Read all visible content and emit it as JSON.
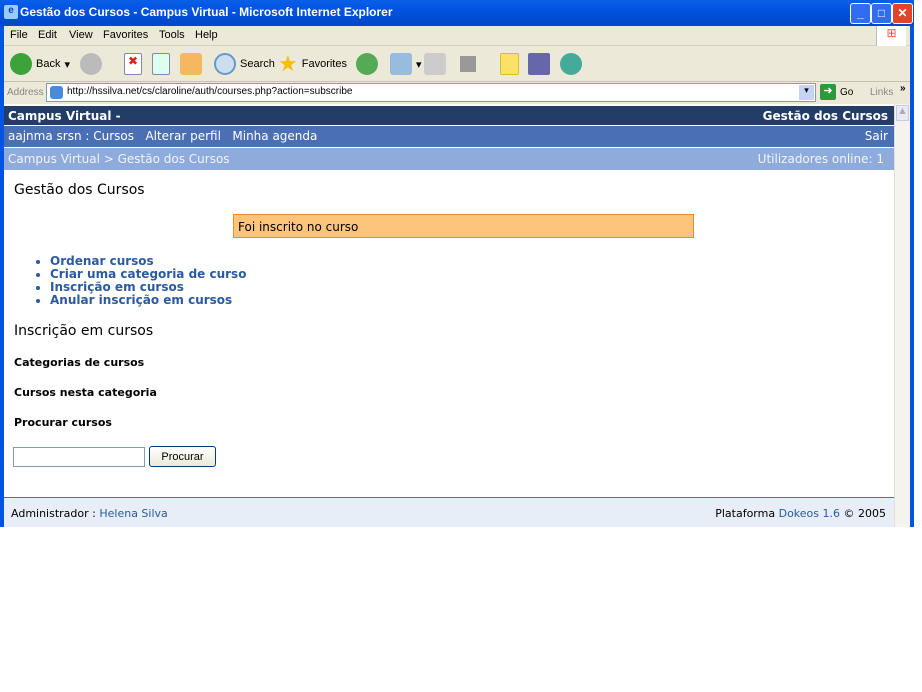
{
  "window": {
    "title": "Gestão dos Cursos - Campus Virtual - Microsoft Internet Explorer"
  },
  "menu": [
    "File",
    "Edit",
    "View",
    "Favorites",
    "Tools",
    "Help"
  ],
  "toolbar": {
    "back": "Back",
    "search": "Search",
    "favorites": "Favorites"
  },
  "address": {
    "label": "Address",
    "url": "http://hssilva.net/cs/claroline/auth/courses.php?action=subscribe",
    "go": "Go",
    "links": "Links"
  },
  "header": {
    "site": "Campus Virtual -",
    "section": "Gestão dos Cursos"
  },
  "nav": {
    "user": "aajnma srsn : Cursos",
    "profile": "Alterar perfil",
    "agenda": "Minha agenda",
    "logout": "Sair"
  },
  "breadcrumb": {
    "path": "Campus Virtual > Gestão dos Cursos",
    "online": "Utilizadores online: 1"
  },
  "main": {
    "title": "Gestão dos Cursos",
    "message": "Foi inscrito no curso",
    "links": [
      "Ordenar cursos",
      "Criar uma categoria de curso",
      "Inscrição em cursos",
      "Anular inscrição em cursos"
    ],
    "subtitle": "Inscrição em cursos",
    "categories": "Categorias de cursos",
    "in_category": "Cursos nesta categoria",
    "search_label": "Procurar cursos",
    "search_value": "",
    "search_button": "Procurar"
  },
  "footer": {
    "admin_label": "Administrador :",
    "admin_name": "Helena Silva",
    "platform_label": "Plataforma",
    "platform_name": "Dokeos 1.6",
    "copyright": "© 2005"
  },
  "colors": {
    "header": "#223d66",
    "nav": "#4a6fb5",
    "breadcrumb": "#8fabdb",
    "message": "#fdc57b",
    "link": "#2b5aa0"
  }
}
